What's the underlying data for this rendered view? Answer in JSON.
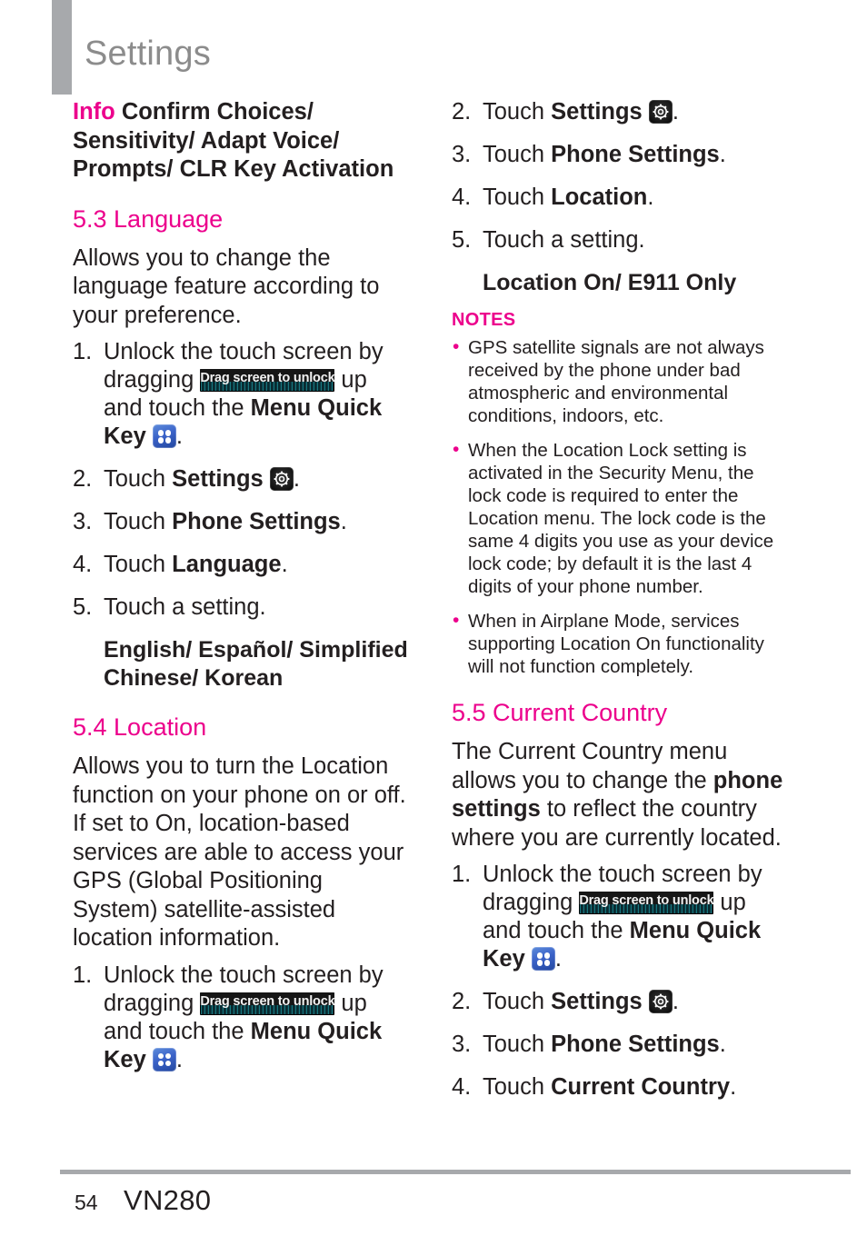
{
  "header": {
    "title": "Settings"
  },
  "footer": {
    "page_number": "54",
    "device_name": "VN280"
  },
  "colors": {
    "accent": "#ec008c",
    "header_gray": "#8c8c8c",
    "rule_gray": "#a7a9ac",
    "body_text": "#231f20"
  },
  "icons": {
    "unlock_badge_label": "Drag screen to unlock",
    "menu_quick_key": "menu-quick-key-icon",
    "settings_gear": "settings-gear-icon"
  },
  "left_column": {
    "info_block": {
      "label": "Info",
      "text": " Confirm Choices/ Sensitivity/ Adapt Voice/ Prompts/ CLR Key Activation"
    },
    "section_language": {
      "heading": "5.3 Language",
      "intro": "Allows you to change the language feature according to your preference.",
      "steps": [
        {
          "num": "1.",
          "pre": "Unlock the touch screen by dragging ",
          "mid": " up and touch the ",
          "bold": "Menu Quick Key",
          "post": "."
        },
        {
          "num": "2.",
          "pre": "Touch ",
          "bold": "Settings",
          "post": "."
        },
        {
          "num": "3.",
          "pre": "Touch ",
          "bold": "Phone Settings",
          "post": "."
        },
        {
          "num": "4.",
          "pre": "Touch ",
          "bold": "Language",
          "post": "."
        },
        {
          "num": "5.",
          "pre": "Touch a setting.",
          "bold": "",
          "post": ""
        }
      ],
      "options": "English/ Español/ Simplified Chinese/ Korean"
    },
    "section_location": {
      "heading": "5.4 Location",
      "intro": "Allows you to turn the Location function on your phone on or off. If set to On, location-based services are able to access your GPS (Global Positioning System) satellite-assisted location information.",
      "steps": [
        {
          "num": "1.",
          "pre": "Unlock the touch screen by dragging ",
          "mid": " up and touch the ",
          "bold": "Menu Quick Key",
          "post": "."
        }
      ]
    }
  },
  "right_column": {
    "location_steps_continued": [
      {
        "num": "2.",
        "pre": "Touch ",
        "bold": "Settings",
        "post": "."
      },
      {
        "num": "3.",
        "pre": "Touch ",
        "bold": "Phone Settings",
        "post": "."
      },
      {
        "num": "4.",
        "pre": "Touch ",
        "bold": "Location",
        "post": "."
      },
      {
        "num": "5.",
        "pre": "Touch a setting.",
        "bold": "",
        "post": ""
      }
    ],
    "location_options": "Location On/ E911 Only",
    "notes": {
      "title": "NOTES",
      "items": [
        "GPS satellite signals are not always received by the phone under bad atmospheric and environmental conditions, indoors, etc.",
        "When the Location Lock setting is activated in the Security Menu, the lock code is required to enter the Location menu. The lock code is the same 4 digits you use as your device lock code; by default it is the last 4 digits of your phone number.",
        "When in Airplane Mode, services supporting Location On functionality will not function completely."
      ]
    },
    "section_current_country": {
      "heading": "5.5 Current Country",
      "intro_pre": "The Current Country menu allows you to change the ",
      "intro_bold": "phone settings",
      "intro_post": " to reflect the country where you are currently located.",
      "steps": [
        {
          "num": "1.",
          "pre": "Unlock the touch screen by dragging ",
          "mid": " up and touch the ",
          "bold": "Menu Quick Key",
          "post": "."
        },
        {
          "num": "2.",
          "pre": "Touch ",
          "bold": "Settings",
          "post": "."
        },
        {
          "num": "3.",
          "pre": "Touch ",
          "bold": "Phone Settings",
          "post": "."
        },
        {
          "num": "4.",
          "pre": "Touch ",
          "bold": "Current Country",
          "post": "."
        }
      ]
    }
  }
}
